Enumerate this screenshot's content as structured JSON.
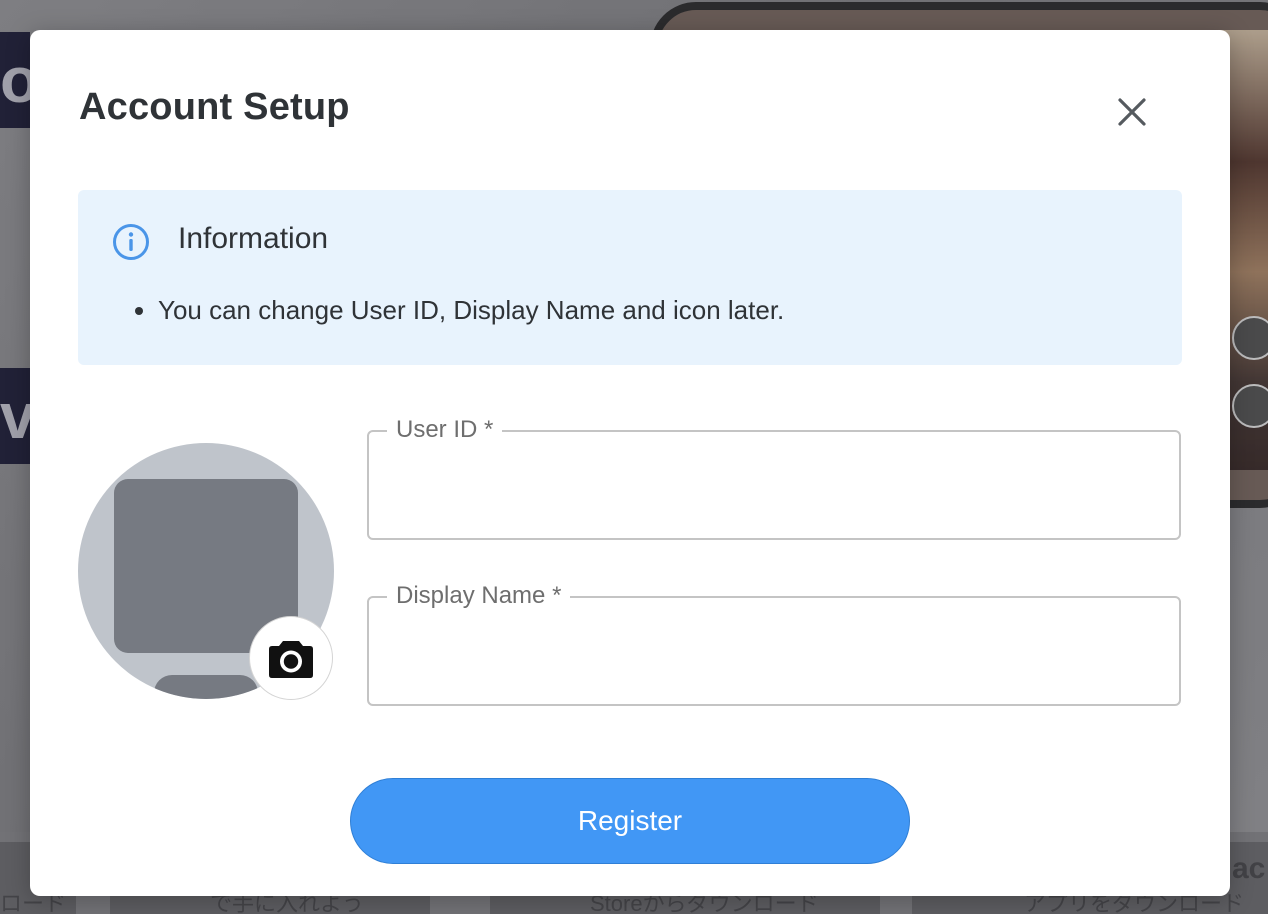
{
  "background": {
    "left_block_1_text": "oh",
    "left_block_2_text": "ve",
    "store_1_bottom_text": "で手に入れよう",
    "store_2_bottom_text": "Storeからダウンロード",
    "store_3_bottom_text": "アプリをダウンロード",
    "left_edge_text": "ロード",
    "right_edge_text": "ac"
  },
  "modal": {
    "title": "Account Setup",
    "close_icon": "close-icon",
    "info": {
      "icon": "info-icon",
      "heading": "Information",
      "items": [
        "You can change User ID, Display Name and icon later."
      ]
    },
    "avatar": {
      "icon": "default-avatar-icon",
      "camera_icon": "camera-icon"
    },
    "fields": {
      "user_id": {
        "label": "User ID",
        "required_mark": "*",
        "value": ""
      },
      "display_name": {
        "label": "Display Name",
        "required_mark": "*",
        "value": ""
      }
    },
    "register_label": "Register"
  },
  "colors": {
    "primary": "#4197f5",
    "info_bg": "#e8f3fd",
    "info_icon": "#4a95e8",
    "title_text": "#2f3337"
  }
}
